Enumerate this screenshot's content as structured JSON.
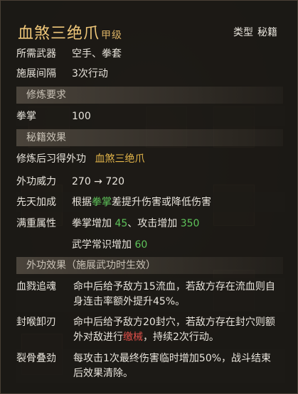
{
  "skill": {
    "name": "血煞三绝爪",
    "grade": "甲级",
    "type_key": "类型",
    "type_value": "秘籍"
  },
  "basics": {
    "weapon_key": "所需武器",
    "weapon_value": "空手、拳套",
    "interval_key": "施展间隔",
    "interval_value": "3次行动"
  },
  "requirements": {
    "header": "修炼要求",
    "stat_key": "拳掌",
    "stat_value": "100"
  },
  "effects": {
    "header": "秘籍效果",
    "learn_key": "修炼后习得外功",
    "learn_value": "血煞三绝爪",
    "power_key": "外功威力",
    "power_value": "270 → 720",
    "innate_key": "先天加成",
    "innate_pre": "根据",
    "innate_stat": "拳掌",
    "innate_post": "差提升伤害或降低伤害",
    "full_key": "满重属性",
    "full_a_pre": "拳掌增加 ",
    "full_a_val": "45",
    "full_b_pre": "、攻击增加 ",
    "full_b_val": "350",
    "full_c_pre": "武学常识增加 ",
    "full_c_val": "60"
  },
  "combat_effects": {
    "header": "外功效果（施展武功时生效）",
    "e1_key": "血戮追魂",
    "e1_line1": "命中后给予敌方15流血，若敌方存在流血则自",
    "e1_line2": "身连击率额外提升45%。",
    "e2_key": "封喉卸刃",
    "e2_line1": "命中后给予敌方20封穴，若敌方存在封穴则额",
    "e2_line2_pre": "外对敌进行",
    "e2_line2_red": "缴械",
    "e2_line2_post": "，持续2次行动。",
    "e3_key": "裂骨叠劲",
    "e3_line1": "每攻击1次最终伤害临时增加50%，战斗结束",
    "e3_line2": "后效果清除。"
  },
  "colors": {
    "title": "#f0c87a",
    "highlight_yellow": "#e7b84a",
    "highlight_green": "#5ec45a",
    "highlight_red": "#e0504a"
  }
}
